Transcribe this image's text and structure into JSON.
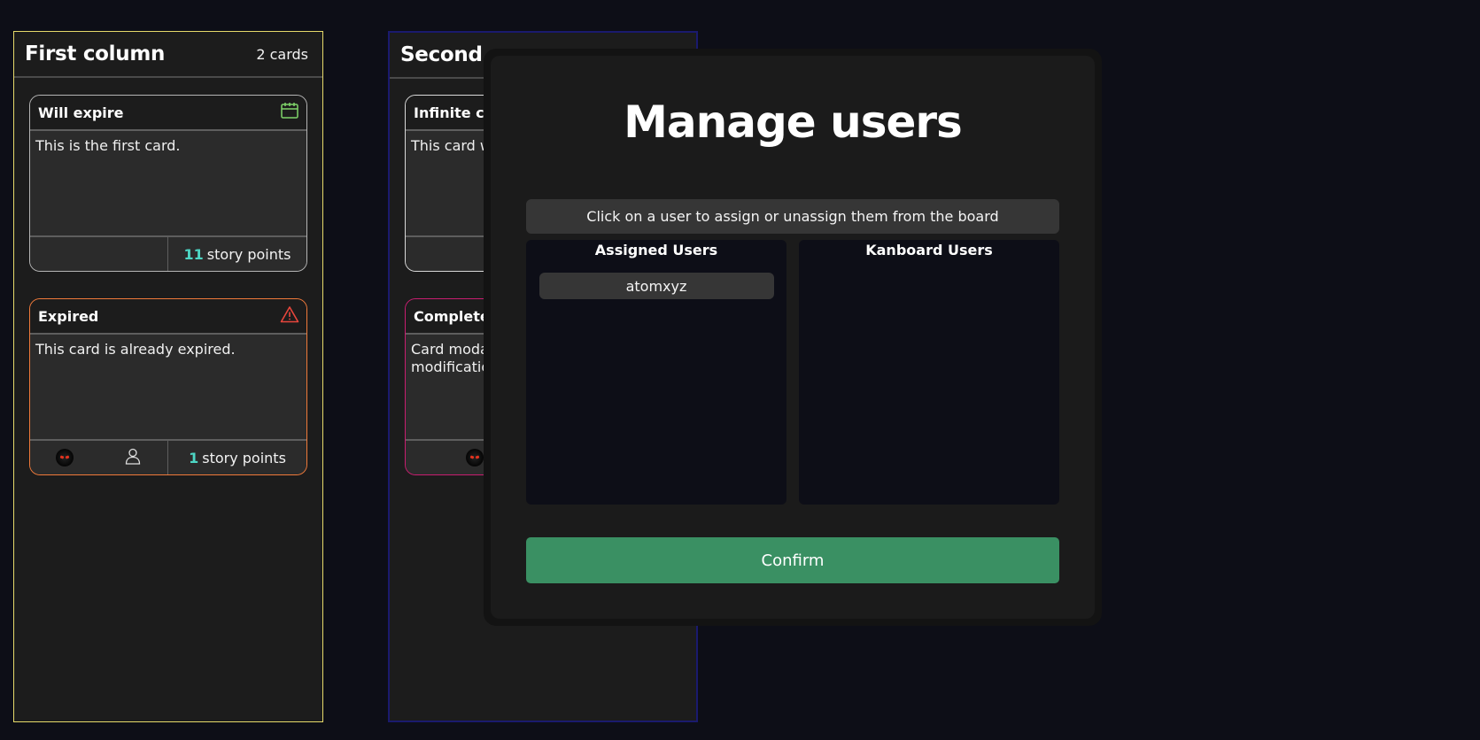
{
  "columns": [
    {
      "title": "First column",
      "count": "2 cards",
      "cards": [
        {
          "title": "Will expire",
          "body": "This is the first card.",
          "points": "11",
          "points_label": "story points",
          "status_icon": "calendar-icon",
          "border_color": "#b5b5b5"
        },
        {
          "title": "Expired",
          "body": "This card is already expired.",
          "points": "1",
          "points_label": "story points",
          "status_icon": "warning-icon",
          "border_color": "#f07a3a"
        }
      ]
    },
    {
      "title": "Second c",
      "cards": [
        {
          "title": "Infinite car",
          "body": "This card w",
          "border_color": "#d9d9d9"
        },
        {
          "title": "Completed",
          "body": "Card moda\nmodificatio",
          "border_color": "#c81d70"
        }
      ]
    }
  ],
  "modal": {
    "title": "Manage users",
    "hint": "Click on a user to assign or unassign them from the board",
    "assigned_title": "Assigned Users",
    "assigned_users": [
      "atomxyz"
    ],
    "kanboard_title": "Kanboard Users",
    "kanboard_users": [],
    "confirm_label": "Confirm",
    "confirm_color": "#3a9063"
  },
  "colors": {
    "background": "#0d0e17",
    "column": "#1c1c1c",
    "first_column_border": "#e6d96a",
    "second_column_border": "#1a1a6e",
    "points_accent": "#4dd6c4"
  }
}
